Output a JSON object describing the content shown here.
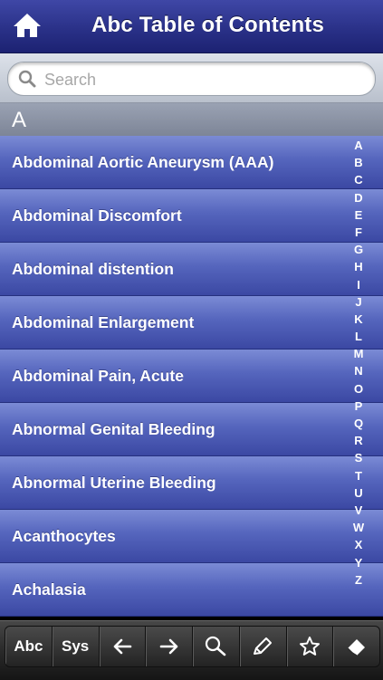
{
  "header": {
    "title": "Abc Table of Contents"
  },
  "search": {
    "placeholder": "Search"
  },
  "section": {
    "letter": "A"
  },
  "items": [
    {
      "label": "Abdominal Aortic Aneurysm (AAA)"
    },
    {
      "label": "Abdominal Discomfort"
    },
    {
      "label": "Abdominal distention"
    },
    {
      "label": "Abdominal Enlargement"
    },
    {
      "label": "Abdominal Pain, Acute"
    },
    {
      "label": "Abnormal Genital Bleeding"
    },
    {
      "label": "Abnormal Uterine Bleeding"
    },
    {
      "label": "Acanthocytes"
    },
    {
      "label": "Achalasia"
    }
  ],
  "index_letters": [
    "A",
    "B",
    "C",
    "D",
    "E",
    "F",
    "G",
    "H",
    "I",
    "J",
    "K",
    "L",
    "M",
    "N",
    "O",
    "P",
    "Q",
    "R",
    "S",
    "T",
    "U",
    "V",
    "W",
    "X",
    "Y",
    "Z"
  ],
  "toolbar": {
    "abc_label": "Abc",
    "sys_label": "Sys"
  },
  "icons": [
    "home-icon",
    "search-icon",
    "back-arrow-icon",
    "forward-arrow-icon",
    "magnifier-icon",
    "pencil-icon",
    "star-icon",
    "eraser-icon"
  ],
  "colors": {
    "header": "#2a3188",
    "row": "#5565bd",
    "toolbar": "#2a2a2a"
  }
}
